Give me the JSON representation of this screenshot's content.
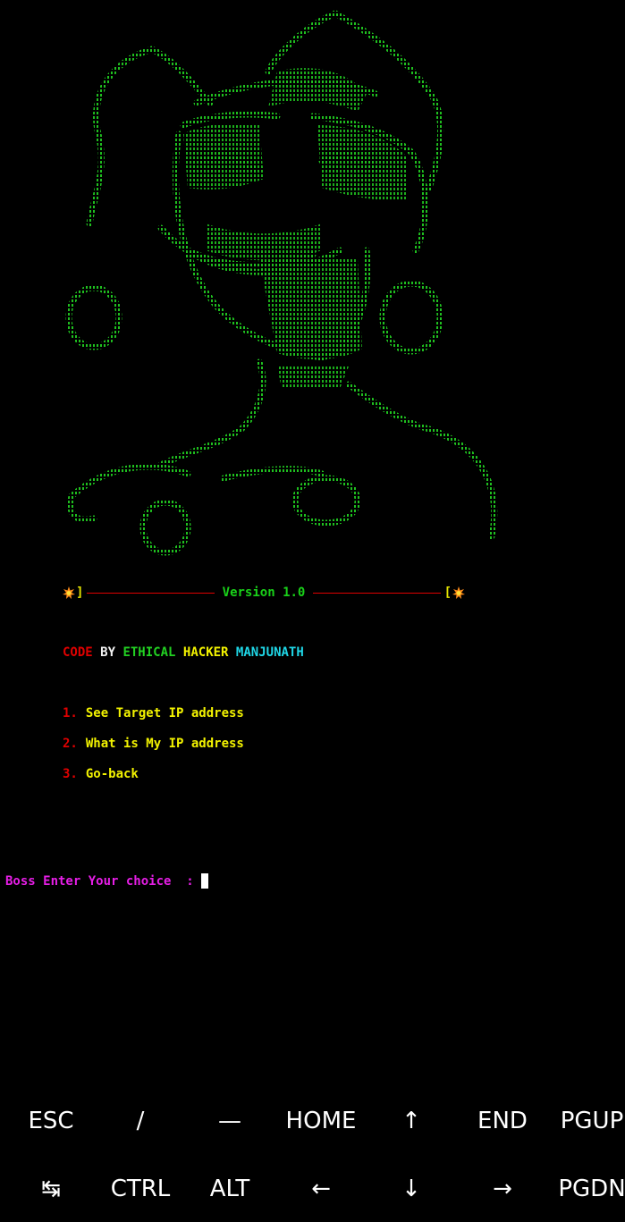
{
  "banner": {
    "version_label": "Version 1.0",
    "left_bracket": "]",
    "right_bracket": "[",
    "burst_icon": "explosion-icon"
  },
  "credit": {
    "code": "CODE",
    "by": "BY",
    "ethical": "ETHICAL",
    "hacker": "HACKER",
    "author": "MANJUNATH"
  },
  "menu": {
    "items": [
      {
        "number": "1.",
        "label": "See Target IP address"
      },
      {
        "number": "2.",
        "label": "What is My IP address"
      },
      {
        "number": "3.",
        "label": "Go-back"
      }
    ]
  },
  "prompt": {
    "text": "Boss Enter Your choice  :"
  },
  "extra_keys": {
    "row1": [
      "ESC",
      "/",
      "—",
      "HOME",
      "↑",
      "END",
      "PGUP"
    ],
    "row2": [
      "↹",
      "CTRL",
      "ALT",
      "←",
      "↓",
      "→",
      "PGDN"
    ]
  },
  "colors": {
    "background": "#000000",
    "art_green": "#1fbf1f",
    "red": "#e00000",
    "yellow": "#f2f200",
    "green": "#22d022",
    "cyan": "#1fd6e6",
    "magenta": "#e61ee6"
  }
}
